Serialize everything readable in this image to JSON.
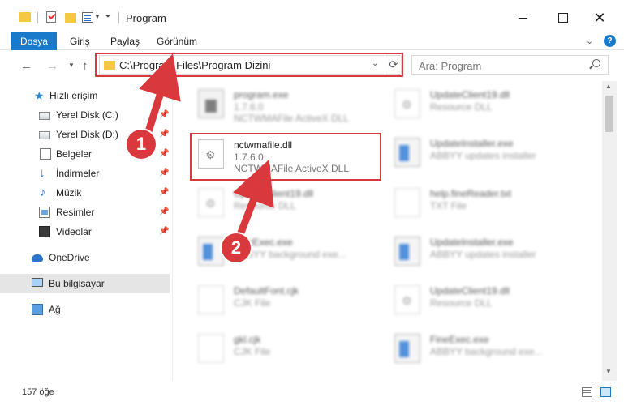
{
  "window": {
    "title": "Program",
    "close_glyph": "✕"
  },
  "ribbon": {
    "tabs": [
      {
        "label": "Dosya"
      },
      {
        "label": "Giriş"
      },
      {
        "label": "Paylaş"
      },
      {
        "label": "Görünüm"
      }
    ],
    "help_glyph": "?"
  },
  "address_bar": {
    "path": "C:\\Program Files\\Program Dizini",
    "search_placeholder": "Ara: Program"
  },
  "sidebar": {
    "items": [
      {
        "label": "Hızlı erişim",
        "icon": "star-icon"
      },
      {
        "label": "Yerel Disk (C:)",
        "icon": "drive-icon",
        "pinned": true
      },
      {
        "label": "Yerel Disk (D:)",
        "icon": "drive-icon",
        "pinned": true
      },
      {
        "label": "Belgeler",
        "icon": "documents-icon",
        "pinned": true
      },
      {
        "label": "İndirmeler",
        "icon": "download-icon",
        "pinned": true
      },
      {
        "label": "Müzik",
        "icon": "music-icon",
        "pinned": true
      },
      {
        "label": "Resimler",
        "icon": "pictures-icon",
        "pinned": true
      },
      {
        "label": "Videolar",
        "icon": "videos-icon",
        "pinned": true
      },
      {
        "label": "OneDrive",
        "icon": "onedrive-icon"
      },
      {
        "label": "Bu bilgisayar",
        "icon": "this-pc-icon",
        "selected": true
      },
      {
        "label": "Ağ",
        "icon": "network-icon"
      }
    ]
  },
  "files": {
    "left": [
      {
        "name": "program.exe",
        "line1": "1.7.6.0",
        "line2": "NCTWMAFile ActiveX DLL",
        "icon": "program-icon",
        "blurred": true
      },
      {
        "name": "nctwmafile.dll",
        "line1": "1.7.6.0",
        "line2": "NCTWMAFile ActiveX DLL",
        "icon": "dll-icon",
        "blurred": false,
        "highlighted": true
      },
      {
        "name": "UpdateClient19.dll",
        "line1": "Resource DLL",
        "line2": "",
        "icon": "dll-icon",
        "blurred": true
      },
      {
        "name": "FineExec.exe",
        "line1": "ABBYY background exe...",
        "line2": "",
        "icon": "exe-icon",
        "blurred": true
      },
      {
        "name": "DefaultFont.cjk",
        "line1": "CJK File",
        "line2": "",
        "icon": "file-icon",
        "blurred": true
      },
      {
        "name": "gkl.cjk",
        "line1": "CJK File",
        "line2": "",
        "icon": "file-icon",
        "blurred": true
      }
    ],
    "right": [
      {
        "name": "UpdateClient19.dll",
        "line1": "Resource DLL",
        "line2": "",
        "icon": "dll-icon"
      },
      {
        "name": "UpdateInstaller.exe",
        "line1": "ABBYY updates installer",
        "line2": "",
        "icon": "exe-icon"
      },
      {
        "name": "help.fineReader.txt",
        "line1": "TXT File",
        "line2": "",
        "icon": "text-file-icon"
      },
      {
        "name": "UpdateInstaller.exe",
        "line1": "ABBYY updates installer",
        "line2": "",
        "icon": "exe-icon"
      },
      {
        "name": "UpdateClient19.dll",
        "line1": "Resource DLL",
        "line2": "",
        "icon": "dll-icon"
      },
      {
        "name": "FineExec.exe",
        "line1": "ABBYY background exe...",
        "line2": "",
        "icon": "exe-icon"
      }
    ]
  },
  "callouts": {
    "step1": "1",
    "step2": "2"
  },
  "status": {
    "item_count": "157 öğe"
  },
  "colors": {
    "accent": "#1979ca",
    "highlight": "#d9383d"
  }
}
